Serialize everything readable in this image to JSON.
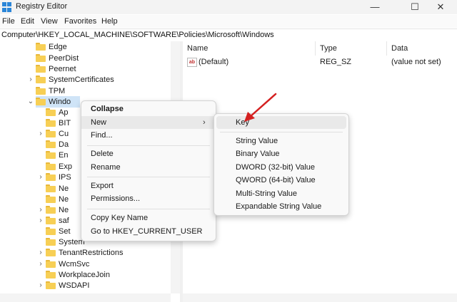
{
  "window": {
    "title": "Registry Editor",
    "minimize": "—",
    "maximize": "☐",
    "close": "✕"
  },
  "menu": [
    "File",
    "Edit",
    "View",
    "Favorites",
    "Help"
  ],
  "address": "Computer\\HKEY_LOCAL_MACHINE\\SOFTWARE\\Policies\\Microsoft\\Windows",
  "tree": [
    "Edge",
    "PeerDist",
    "Peernet",
    "SystemCertificates",
    "TPM",
    "Windo",
    "Ap",
    "BIT",
    "Cu",
    "Da",
    "En",
    "Exp",
    "IPS",
    "Ne",
    "Ne",
    "Ne",
    "saf",
    "Set",
    "System",
    "TenantRestrictions",
    "WcmSvc",
    "WorkplaceJoin",
    "WSDAPI"
  ],
  "list": {
    "columns": [
      "Name",
      "Type",
      "Data"
    ],
    "rows": [
      {
        "name": "(Default)",
        "type": "REG_SZ",
        "data": "(value not set)",
        "icon": "ab"
      }
    ]
  },
  "context_menu": {
    "collapse": "Collapse",
    "new": "New",
    "find": "Find...",
    "delete": "Delete",
    "rename": "Rename",
    "export": "Export",
    "permissions": "Permissions...",
    "copy_key": "Copy Key Name",
    "goto": "Go to HKEY_CURRENT_USER",
    "chevron": "›"
  },
  "submenu": {
    "key": "Key",
    "string": "String Value",
    "binary": "Binary Value",
    "dword": "DWORD (32-bit) Value",
    "qword": "QWORD (64-bit) Value",
    "multi": "Multi-String Value",
    "expandable": "Expandable String Value"
  },
  "colors": {
    "accent": "#2b86d8",
    "folder": "#f7cf55",
    "annotation_arrow": "#d42020"
  }
}
